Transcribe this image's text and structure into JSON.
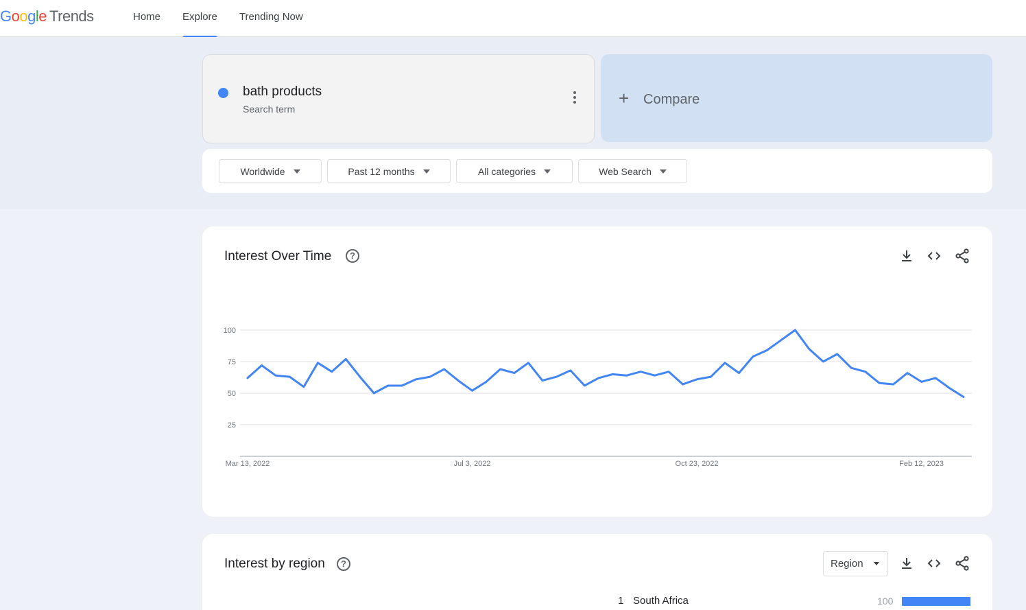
{
  "header": {
    "logo": {
      "part1": "G",
      "part2": "o",
      "part3": "o",
      "part4": "g",
      "part5": "l",
      "part6": "e",
      "product": "Trends"
    },
    "nav": [
      {
        "label": "Home"
      },
      {
        "label": "Explore"
      },
      {
        "label": "Trending Now"
      }
    ]
  },
  "search": {
    "term": "bath products",
    "term_type": "Search term",
    "term_color": "#4285f4",
    "compare_label": "Compare"
  },
  "filters": [
    {
      "label": "Worldwide"
    },
    {
      "label": "Past 12 months"
    },
    {
      "label": "All categories"
    },
    {
      "label": "Web Search"
    }
  ],
  "interest_over_time": {
    "title": "Interest Over Time",
    "help": "?"
  },
  "interest_by_region": {
    "title": "Interest by region",
    "help": "?",
    "select_value": "Region",
    "rows": [
      {
        "rank": "1",
        "name": "South Africa",
        "value": "100",
        "fraction": 1.0
      }
    ]
  },
  "chart_data": {
    "type": "line",
    "series": [
      {
        "values": [
          62,
          72,
          64,
          63,
          55,
          74,
          67,
          77,
          63,
          50,
          56,
          56,
          61,
          63,
          69,
          60,
          52,
          59,
          69,
          66,
          74,
          60,
          63,
          68,
          56,
          62,
          65,
          64,
          67,
          64,
          67,
          57,
          61,
          63,
          74,
          66,
          79,
          84,
          92,
          100,
          85,
          75,
          81,
          70,
          67,
          58,
          57,
          66,
          59,
          62,
          54,
          47
        ],
        "color": "#4285f4"
      }
    ],
    "x_ticks": [
      "Mar 13, 2022",
      "Jul 3, 2022",
      "Oct 23, 2022",
      "Feb 12, 2023"
    ],
    "y_ticks": [
      "25",
      "50",
      "75",
      "100"
    ],
    "ylim": [
      0,
      100
    ],
    "grid": true
  }
}
